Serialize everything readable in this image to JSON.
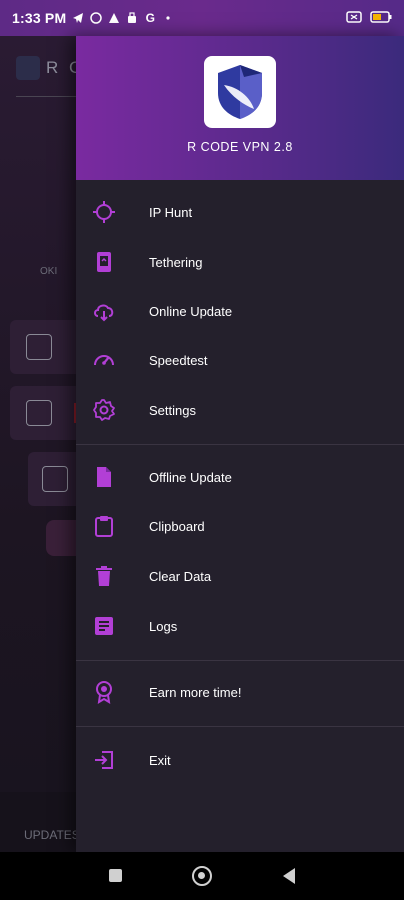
{
  "status_bar": {
    "time": "1:33 PM",
    "icons": [
      "telegram-icon",
      "messenger-icon",
      "warning-icon",
      "shopping-bag-icon",
      "g-icon",
      "dot-icon"
    ],
    "right_icons": [
      "screen-record-icon",
      "battery-icon"
    ]
  },
  "background_app": {
    "title": "R C",
    "ok_label": "OKI",
    "updates_label": "UPDATES"
  },
  "drawer": {
    "app_name": "R CODE VPN  2.8",
    "items_group1": [
      {
        "label": "IP Hunt",
        "icon": "crosshair-icon"
      },
      {
        "label": "Tethering",
        "icon": "phone-icon"
      },
      {
        "label": "Online Update",
        "icon": "cloud-download-icon"
      },
      {
        "label": "Speedtest",
        "icon": "speedometer-icon"
      },
      {
        "label": "Settings",
        "icon": "gear-icon"
      }
    ],
    "items_group2": [
      {
        "label": "Offline Update",
        "icon": "file-icon"
      },
      {
        "label": "Clipboard",
        "icon": "clipboard-icon"
      },
      {
        "label": "Clear Data",
        "icon": "trash-icon"
      },
      {
        "label": "Logs",
        "icon": "notes-icon"
      }
    ],
    "items_group3": [
      {
        "label": "Earn more time!",
        "icon": "award-icon"
      }
    ],
    "items_group4": [
      {
        "label": "Exit",
        "icon": "exit-icon"
      }
    ]
  },
  "colors": {
    "accent": "#b23fd6",
    "drawer_bg": "#24202c",
    "header_start": "#7a2aa0",
    "header_end": "#3b2a7c"
  }
}
